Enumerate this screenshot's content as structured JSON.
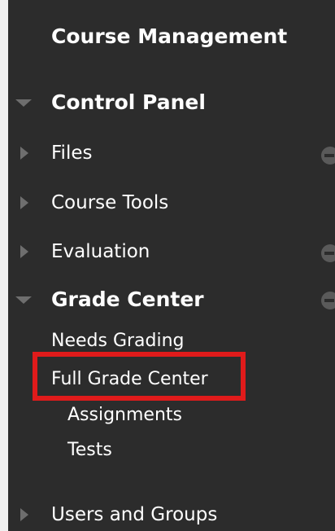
{
  "section_title": "Course Management",
  "control_panel": {
    "label": "Control Panel",
    "items": [
      {
        "label": "Files"
      },
      {
        "label": "Course Tools"
      },
      {
        "label": "Evaluation"
      },
      {
        "label": "Grade Center"
      }
    ]
  },
  "grade_center": {
    "subitems": [
      {
        "label": "Needs Grading"
      },
      {
        "label": "Full Grade Center"
      },
      {
        "label": "Assignments"
      },
      {
        "label": "Tests"
      }
    ]
  },
  "users_and_groups": {
    "label": "Users and Groups"
  },
  "icons": {
    "collapsed_arrow": "caret-right-icon",
    "expanded_arrow": "caret-down-icon",
    "edge_control": "remove-circle-icon"
  },
  "colors": {
    "panel_background": "#2c2c2c",
    "text": "#ffffff",
    "highlight": "#e01b1b"
  }
}
